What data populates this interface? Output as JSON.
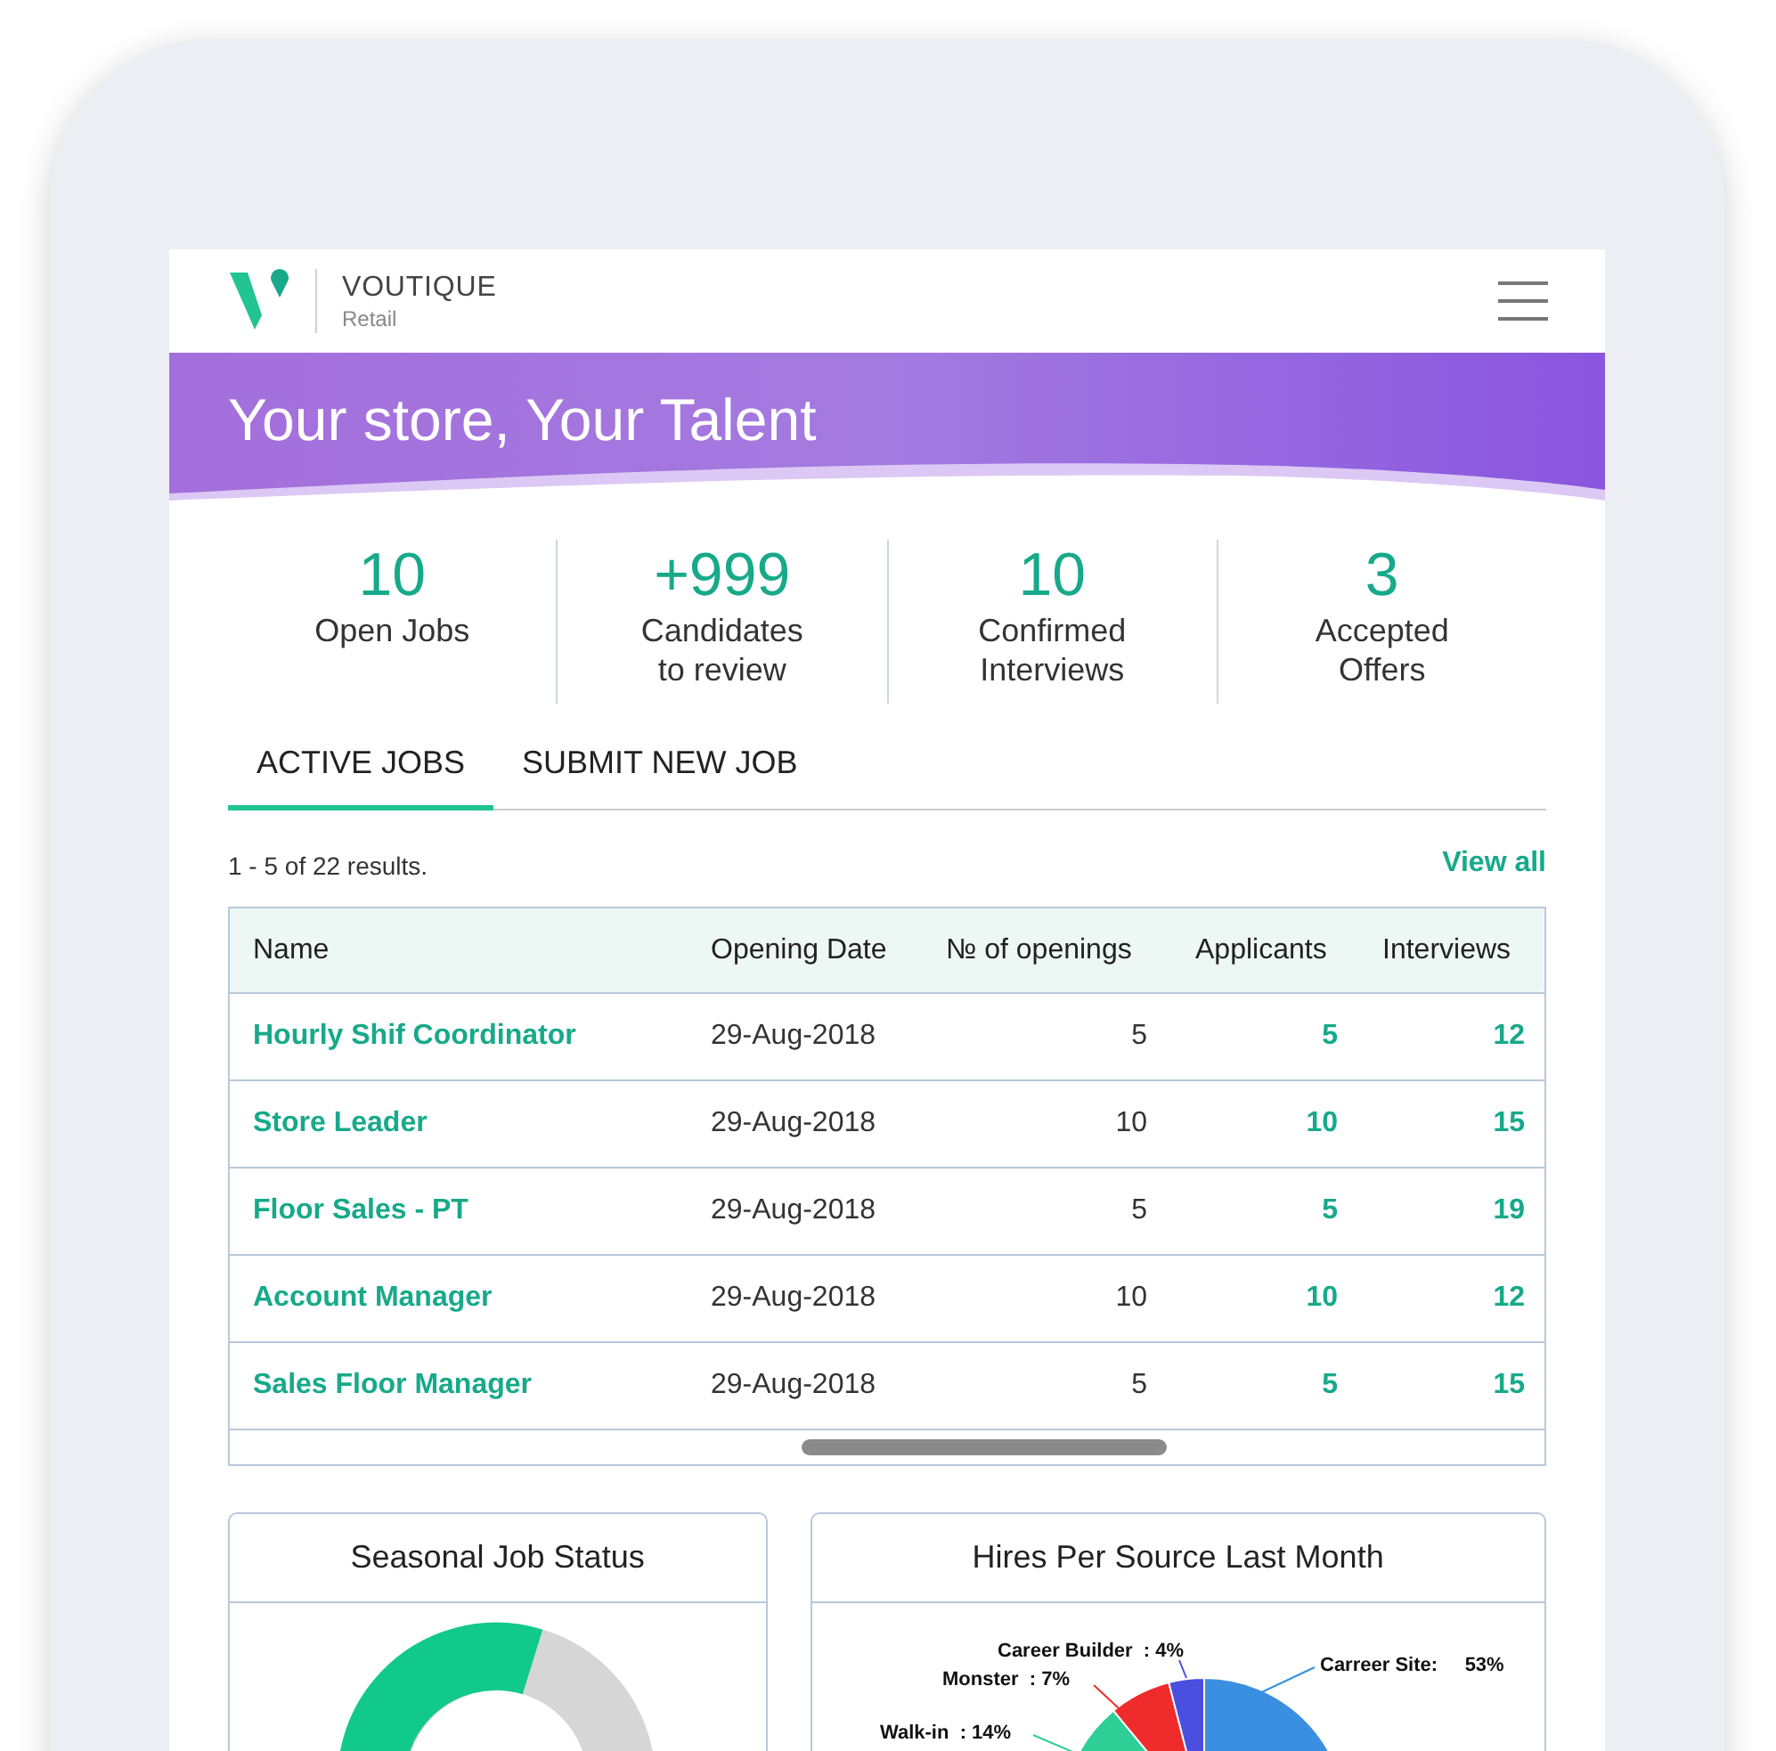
{
  "header": {
    "brand": "VOUTIQUE",
    "subtitle": "Retail"
  },
  "banner": {
    "title": "Your store, Your Talent"
  },
  "stats": [
    {
      "value": "10",
      "label": "Open Jobs"
    },
    {
      "value": "+999",
      "label": "Candidates\nto review"
    },
    {
      "value": "10",
      "label": "Confirmed Interviews"
    },
    {
      "value": "3",
      "label": "Accepted Offers"
    }
  ],
  "tabs": [
    {
      "label": "ACTIVE JOBS",
      "selected": true
    },
    {
      "label": "SUBMIT NEW JOB",
      "selected": false
    }
  ],
  "results": {
    "summary": "1 - 5 of 22 results.",
    "link": "View all"
  },
  "table": {
    "columns": [
      "Name",
      "Opening Date",
      "№ of openings",
      "Applicants",
      "Interviews"
    ],
    "rows": [
      {
        "name": "Hourly Shif Coordinator",
        "date": "29-Aug-2018",
        "openings": "5",
        "applicants": "5",
        "interviews": "12"
      },
      {
        "name": "Store Leader",
        "date": "29-Aug-2018",
        "openings": "10",
        "applicants": "10",
        "interviews": "15"
      },
      {
        "name": "Floor Sales - PT",
        "date": "29-Aug-2018",
        "openings": "5",
        "applicants": "5",
        "interviews": "19"
      },
      {
        "name": "Account Manager",
        "date": "29-Aug-2018",
        "openings": "10",
        "applicants": "10",
        "interviews": "12"
      },
      {
        "name": "Sales Floor Manager",
        "date": "29-Aug-2018",
        "openings": "5",
        "applicants": "5",
        "interviews": "15"
      }
    ]
  },
  "cards": [
    {
      "title": "Seasonal Job Status"
    },
    {
      "title": "Hires Per Source Last Month",
      "chart_data": {
        "type": "pie",
        "categories": [
          "Carreer Site",
          "Walk-in",
          "Monster",
          "Career Builder"
        ],
        "values": [
          53,
          14,
          7,
          4
        ],
        "colors": [
          "#3b8fe0",
          "#2ecf96",
          "#f02b2b",
          "#4a4fe0"
        ],
        "value_labels": [
          ":     53%",
          "  : 14%",
          "  : 7%",
          "  : 4%"
        ]
      }
    }
  ]
}
